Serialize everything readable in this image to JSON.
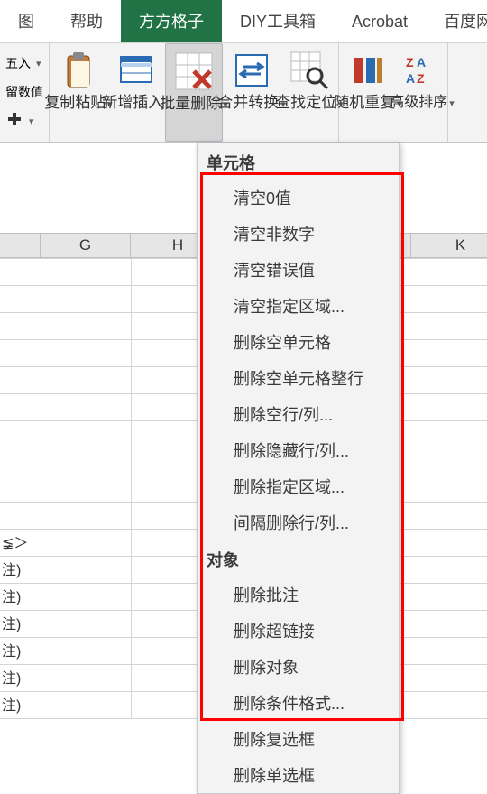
{
  "tabs": {
    "t0": "图",
    "t1": "帮助",
    "t2": "方方格子",
    "t3": "DIY工具箱",
    "t4": "Acrobat",
    "t5": "百度网盘"
  },
  "ribbon": {
    "stacked": {
      "row1": "五入",
      "row2": "留数值"
    },
    "copy_paste": "复制粘贴",
    "insert_new": "新增插入",
    "batch_delete": "批量删除",
    "merge_convert": "合并转换",
    "find_locate": "查找定位",
    "random_repeat": "随机重复",
    "adv_sort": "高级排序",
    "drop_glyph": "▾"
  },
  "right_trim": "数",
  "col_headers": {
    "g": "G",
    "h": "H",
    "k": "K"
  },
  "cells": {
    "r1": "≨＞",
    "r2": "注)",
    "r3": "注)",
    "r4": "注)",
    "r5": "注)",
    "r6": "注)",
    "r7": "注)"
  },
  "dropdown": {
    "section1": "单元格",
    "items1": [
      "清空0值",
      "清空非数字",
      "清空错误值",
      "清空指定区域...",
      "删除空单元格",
      "删除空单元格整行",
      "删除空行/列...",
      "删除隐藏行/列...",
      "删除指定区域...",
      "间隔删除行/列..."
    ],
    "section2": "对象",
    "items2": [
      "删除批注",
      "删除超链接",
      "删除对象",
      "删除条件格式...",
      "删除复选框",
      "删除单选框"
    ]
  }
}
